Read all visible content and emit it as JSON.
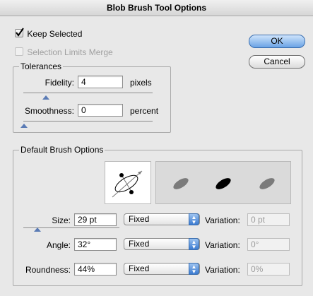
{
  "title": "Blob Brush Tool Options",
  "keep_selected": {
    "label": "Keep Selected",
    "checked": true
  },
  "selection_limits": {
    "label": "Selection Limits Merge",
    "checked": false,
    "enabled": false
  },
  "buttons": {
    "ok": "OK",
    "cancel": "Cancel"
  },
  "tolerances": {
    "legend": "Tolerances",
    "fidelity": {
      "label": "Fidelity:",
      "value": "4",
      "unit": "pixels"
    },
    "smoothness": {
      "label": "Smoothness:",
      "value": "0",
      "unit": "percent"
    }
  },
  "brush": {
    "legend": "Default Brush Options",
    "size": {
      "label": "Size:",
      "value": "29 pt",
      "mode": "Fixed",
      "variation_label": "Variation:",
      "variation": "0 pt"
    },
    "angle": {
      "label": "Angle:",
      "value": "32°",
      "mode": "Fixed",
      "variation_label": "Variation:",
      "variation": "0°"
    },
    "roundness": {
      "label": "Roundness:",
      "value": "44%",
      "mode": "Fixed",
      "variation_label": "Variation:",
      "variation": "0%"
    }
  },
  "colors": {
    "accent": "#3a7ad0",
    "preview_gray": "#808080"
  },
  "icons": [
    "checkbox-icon",
    "brush-angle-icon",
    "brush-preview-icon",
    "dropdown-arrow-icon",
    "slider-thumb-icon"
  ]
}
